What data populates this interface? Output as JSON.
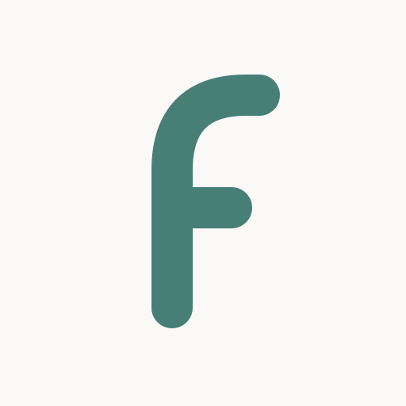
{
  "logo": {
    "name": "F",
    "color": "#477f77",
    "background": "#faf9f7"
  }
}
